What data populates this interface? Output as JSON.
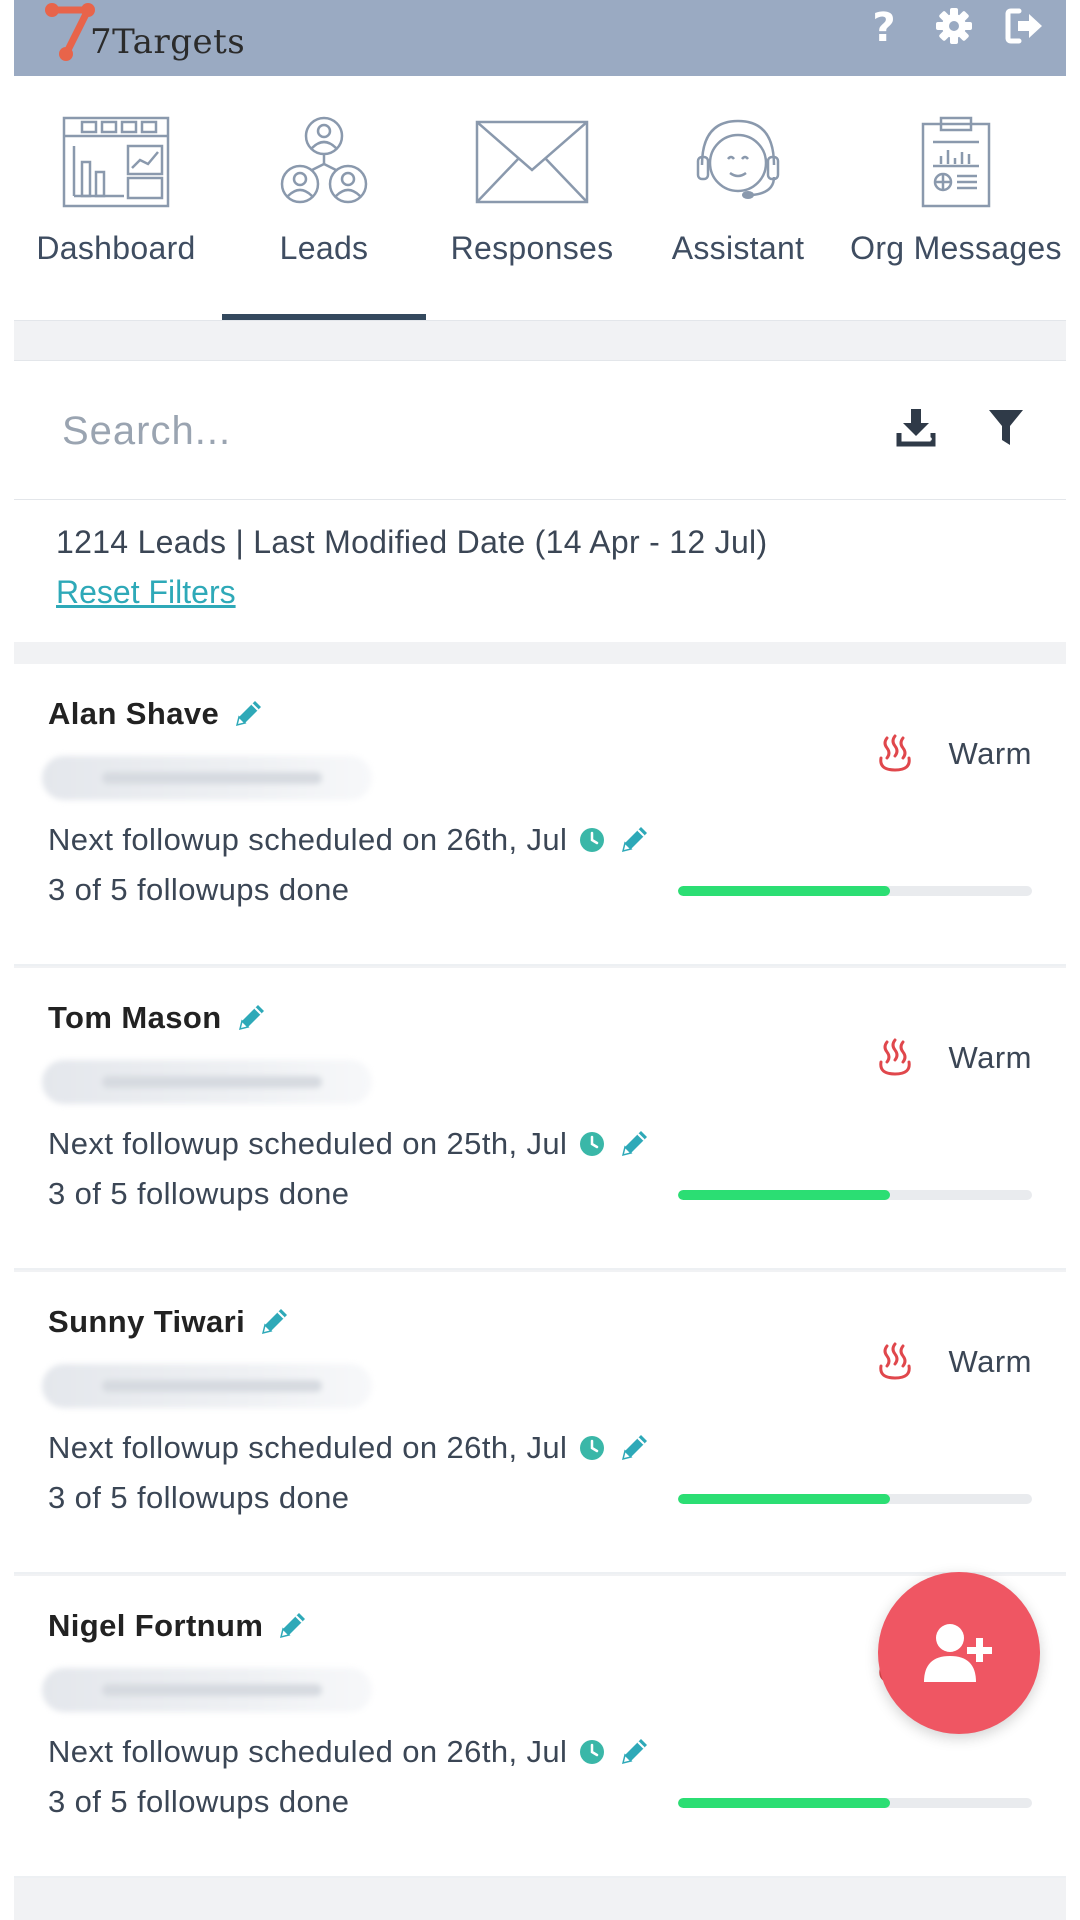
{
  "app": {
    "brand": "7Targets",
    "colors": {
      "header": "#9aaac2",
      "accent": "#2ea9b8",
      "progress": "#2bde73",
      "fab": "#ef5663",
      "warm": "#e0474c"
    }
  },
  "top_actions": [
    {
      "icon": "help-icon"
    },
    {
      "icon": "settings-icon"
    },
    {
      "icon": "logout-icon"
    }
  ],
  "nav": {
    "items": [
      {
        "label": "Dashboard",
        "icon": "dashboard-icon"
      },
      {
        "label": "Leads",
        "icon": "leads-icon",
        "active": true
      },
      {
        "label": "Responses",
        "icon": "mail-icon"
      },
      {
        "label": "Assistant",
        "icon": "headset-icon"
      },
      {
        "label": "Org Messages",
        "icon": "clipboard-icon"
      }
    ]
  },
  "search": {
    "placeholder": "Search...",
    "value": ""
  },
  "summary": {
    "text": "1214 Leads | Last Modified Date (14 Apr - 12 Jul)",
    "reset_label": "Reset Filters"
  },
  "leads": [
    {
      "name": "Alan Shave",
      "status": "Warm",
      "followup": "Next followup scheduled on 26th, Jul",
      "progress_text": "3 of 5 followups done",
      "progress": 0.6
    },
    {
      "name": "Tom Mason",
      "status": "Warm",
      "followup": "Next followup scheduled on 25th, Jul",
      "progress_text": "3 of 5 followups done",
      "progress": 0.6
    },
    {
      "name": "Sunny Tiwari",
      "status": "Warm",
      "followup": "Next followup scheduled on 26th, Jul",
      "progress_text": "3 of 5 followups done",
      "progress": 0.6
    },
    {
      "name": "Nigel Fortnum",
      "status": "Warm",
      "followup": "Next followup scheduled on 26th, Jul",
      "progress_text": "3 of 5 followups done",
      "progress": 0.6
    }
  ],
  "fab": {
    "icon": "add-user-icon"
  }
}
